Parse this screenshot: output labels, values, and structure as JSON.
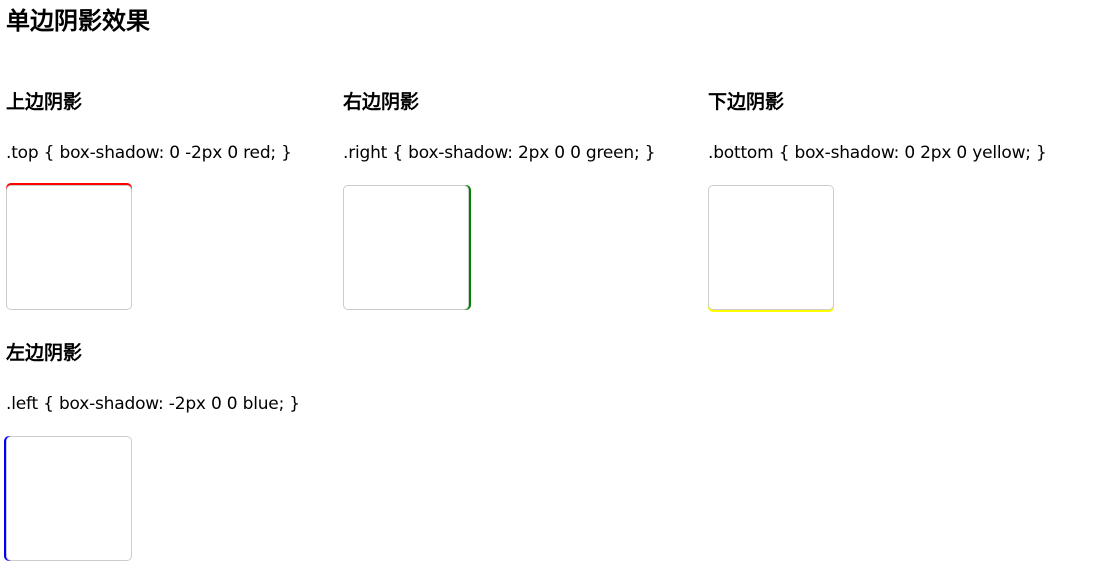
{
  "page": {
    "title": "单边阴影效果"
  },
  "demos": [
    {
      "heading": "上边阴影",
      "code": ".top { box-shadow: 0 -2px 0 red; }",
      "shadow_color": "#ff0000"
    },
    {
      "heading": "右边阴影",
      "code": ".right { box-shadow: 2px 0 0 green; }",
      "shadow_color": "#008000"
    },
    {
      "heading": "下边阴影",
      "code": ".bottom { box-shadow: 0 2px 0 yellow; }",
      "shadow_color": "#ffff00"
    },
    {
      "heading": "左边阴影",
      "code": ".left { box-shadow: -2px 0 0 blue; }",
      "shadow_color": "#0000ff"
    }
  ]
}
